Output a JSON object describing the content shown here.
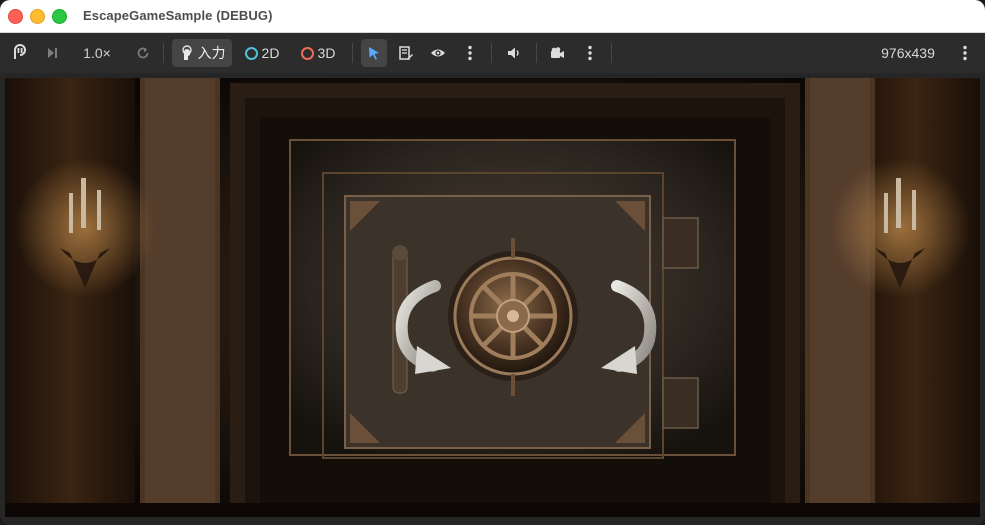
{
  "window": {
    "title": "EscapeGameSample (DEBUG)"
  },
  "toolbar": {
    "speed": "1.0×",
    "input_label": "入力",
    "mode_2d": "2D",
    "mode_3d": "3D",
    "resolution": "976x439"
  },
  "colors": {
    "mode_2d_ring": "#4fc3d8",
    "mode_3d_ring": "#f06a5b",
    "select_arrow": "#5aa9ff"
  },
  "icons": [
    "pause-icon",
    "step-frame-icon",
    "reset-icon",
    "input-hand-icon",
    "select-cursor-icon",
    "list-edit-icon",
    "visibility-eye-icon",
    "more-options-icon",
    "volume-icon",
    "camera-icon"
  ]
}
